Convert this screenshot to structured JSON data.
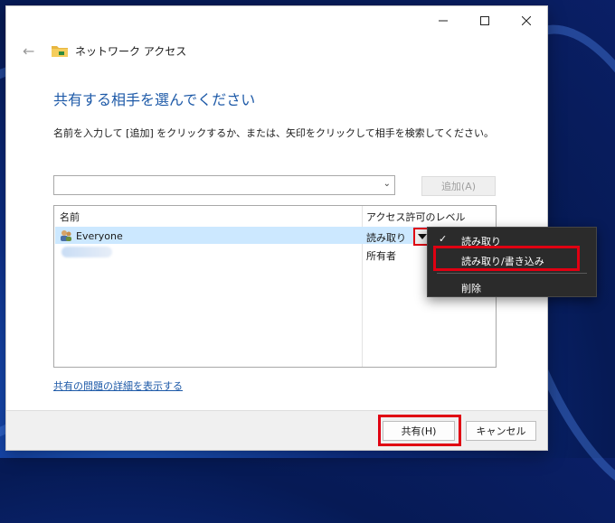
{
  "dialog": {
    "title": "ネットワーク アクセス",
    "heading": "共有する相手を選んでください",
    "instruction": "名前を入力して [追加] をクリックするか、または、矢印をクリックして相手を検索してください。",
    "input": {
      "value": "",
      "placeholder": ""
    },
    "add_button": "追加(A)",
    "columns": {
      "name": "名前",
      "access": "アクセス許可のレベル"
    },
    "rows": [
      {
        "name": "Everyone",
        "access": "読み取り",
        "selected": true,
        "icon": "users-icon"
      },
      {
        "name": "",
        "access": "所有者",
        "selected": false,
        "icon": "user-icon"
      }
    ],
    "help_link": "共有の問題の詳細を表示する",
    "share_button": "共有(H)",
    "cancel_button": "キャンセル"
  },
  "access_menu": {
    "items": [
      {
        "label": "読み取り",
        "checked": true
      },
      {
        "label": "読み取り/書き込み",
        "checked": false
      },
      {
        "label": "削除",
        "checked": false
      }
    ],
    "check_glyph": "✓"
  },
  "colors": {
    "accent": "#1e5aa8",
    "highlight": "#e00012",
    "selection": "#cce8ff",
    "menu_bg": "#2b2b2b"
  }
}
